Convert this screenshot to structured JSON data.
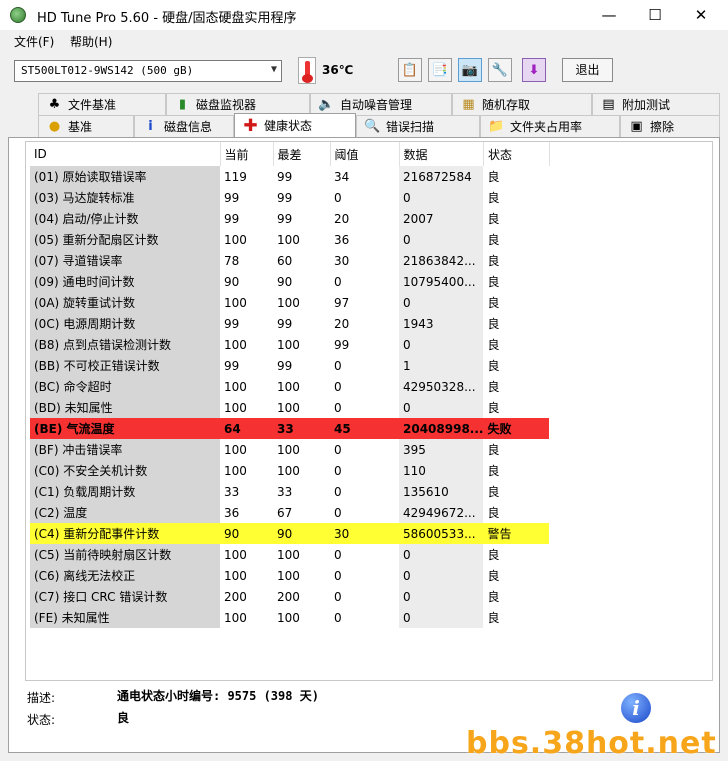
{
  "window": {
    "title": "HD Tune Pro 5.60 - 硬盘/固态硬盘实用程序",
    "minimize": "—",
    "maximize": "☐",
    "close": "✕"
  },
  "menu": [
    "文件(F)",
    "帮助(H)"
  ],
  "toolbar": {
    "drive": "ST500LT012-9WS142 (500 gB)",
    "temperature": "36℃",
    "exit_label": "退出"
  },
  "tabs_row1": [
    "文件基准",
    "磁盘监视器",
    "自动噪音管理",
    "随机存取",
    "附加测试"
  ],
  "tabs_row2": [
    "基准",
    "磁盘信息",
    "健康状态",
    "错误扫描",
    "文件夹占用率",
    "擦除"
  ],
  "active_tab": "健康状态",
  "table": {
    "headers": [
      "ID",
      "当前",
      "最差",
      "阈值",
      "数据",
      "状态"
    ],
    "rows": [
      {
        "id": "(01) 原始读取错误率",
        "cur": "119",
        "worst": "99",
        "thr": "34",
        "data": "216872584",
        "status": "良"
      },
      {
        "id": "(03) 马达旋转标准",
        "cur": "99",
        "worst": "99",
        "thr": "0",
        "data": "0",
        "status": "良"
      },
      {
        "id": "(04) 启动/停止计数",
        "cur": "99",
        "worst": "99",
        "thr": "20",
        "data": "2007",
        "status": "良"
      },
      {
        "id": "(05) 重新分配扇区计数",
        "cur": "100",
        "worst": "100",
        "thr": "36",
        "data": "0",
        "status": "良"
      },
      {
        "id": "(07) 寻道错误率",
        "cur": "78",
        "worst": "60",
        "thr": "30",
        "data": "21863842...",
        "status": "良"
      },
      {
        "id": "(09) 通电时间计数",
        "cur": "90",
        "worst": "90",
        "thr": "0",
        "data": "10795400...",
        "status": "良"
      },
      {
        "id": "(0A) 旋转重试计数",
        "cur": "100",
        "worst": "100",
        "thr": "97",
        "data": "0",
        "status": "良"
      },
      {
        "id": "(0C) 电源周期计数",
        "cur": "99",
        "worst": "99",
        "thr": "20",
        "data": "1943",
        "status": "良"
      },
      {
        "id": "(B8) 点到点错误检测计数",
        "cur": "100",
        "worst": "100",
        "thr": "99",
        "data": "0",
        "status": "良"
      },
      {
        "id": "(BB) 不可校正错误计数",
        "cur": "99",
        "worst": "99",
        "thr": "0",
        "data": "1",
        "status": "良"
      },
      {
        "id": "(BC) 命令超时",
        "cur": "100",
        "worst": "100",
        "thr": "0",
        "data": "42950328...",
        "status": "良"
      },
      {
        "id": "(BD) 未知属性",
        "cur": "100",
        "worst": "100",
        "thr": "0",
        "data": "0",
        "status": "良"
      },
      {
        "id": "(BE) 气流温度",
        "cur": "64",
        "worst": "33",
        "thr": "45",
        "data": "20408998...",
        "status": "失败"
      },
      {
        "id": "(BF) 冲击错误率",
        "cur": "100",
        "worst": "100",
        "thr": "0",
        "data": "395",
        "status": "良"
      },
      {
        "id": "(C0) 不安全关机计数",
        "cur": "100",
        "worst": "100",
        "thr": "0",
        "data": "110",
        "status": "良"
      },
      {
        "id": "(C1) 负载周期计数",
        "cur": "33",
        "worst": "33",
        "thr": "0",
        "data": "135610",
        "status": "良"
      },
      {
        "id": "(C2) 温度",
        "cur": "36",
        "worst": "67",
        "thr": "0",
        "data": "42949672...",
        "status": "良"
      },
      {
        "id": "(C4) 重新分配事件计数",
        "cur": "90",
        "worst": "90",
        "thr": "30",
        "data": "58600533...",
        "status": "警告"
      },
      {
        "id": "(C5) 当前待映射扇区计数",
        "cur": "100",
        "worst": "100",
        "thr": "0",
        "data": "0",
        "status": "良"
      },
      {
        "id": "(C6) 离线无法校正",
        "cur": "100",
        "worst": "100",
        "thr": "0",
        "data": "0",
        "status": "良"
      },
      {
        "id": "(C7) 接口 CRC 错误计数",
        "cur": "200",
        "worst": "200",
        "thr": "0",
        "data": "0",
        "status": "良"
      },
      {
        "id": "(FE) 未知属性",
        "cur": "100",
        "worst": "100",
        "thr": "0",
        "data": "0",
        "status": "良"
      }
    ]
  },
  "footer": {
    "desc_label": "描述:",
    "desc_value": "通电状态小时编号: 9575 (398 天)",
    "status_label": "状态:",
    "status_value": "良",
    "info_icon": "i"
  },
  "watermark": "bbs.38hot.net",
  "colors": {
    "fail_row": "#f53131",
    "warn_row": "#ffff33"
  }
}
